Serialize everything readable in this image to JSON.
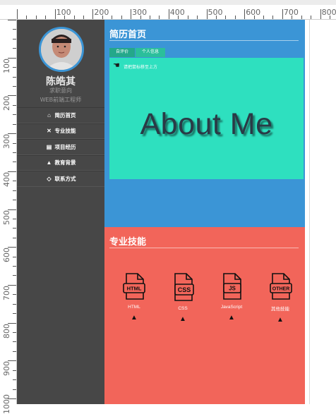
{
  "ruler": {
    "top_labels": [
      "100",
      "200",
      "300",
      "400",
      "500",
      "600",
      "700",
      "800"
    ],
    "left_labels": [
      "100",
      "200",
      "300",
      "400",
      "500",
      "600",
      "700",
      "800",
      "900",
      "1000"
    ]
  },
  "profile": {
    "name": "陈皓其",
    "intent": "求职意向",
    "job": "WEB前端工程师"
  },
  "nav": {
    "items": [
      {
        "label": "简历首页",
        "icon": "home-icon"
      },
      {
        "label": "专业技能",
        "icon": "tools-icon"
      },
      {
        "label": "项目经历",
        "icon": "book-icon"
      },
      {
        "label": "教育背景",
        "icon": "graduation-cap-icon"
      },
      {
        "label": "联系方式",
        "icon": "tag-icon"
      }
    ]
  },
  "home": {
    "title": "简历首页",
    "tabs": [
      "自评价",
      "个人信息"
    ],
    "hint": "请把鼠标移至上方",
    "headline": "About Me"
  },
  "skills": {
    "title": "专业技能",
    "items": [
      {
        "file_type": "HTML",
        "label": "HTML"
      },
      {
        "file_type": "CSS",
        "label": "CSS"
      },
      {
        "file_type": "JS",
        "label": "JavaScript"
      },
      {
        "file_type": "OTHER",
        "label": "其他技能"
      }
    ]
  },
  "colors": {
    "sidebar": "#474747",
    "home_bg": "#3b95d6",
    "card_bg": "#2ee0bf",
    "skills_bg": "#f2655a"
  }
}
